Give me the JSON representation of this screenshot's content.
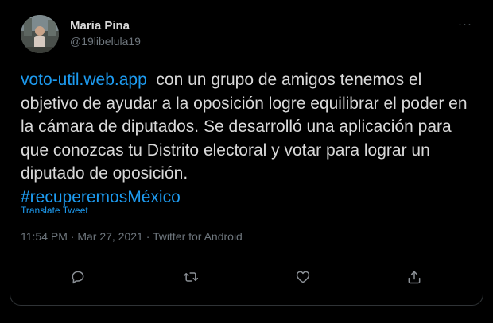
{
  "tweet": {
    "author_name": "Maria Pina",
    "author_handle": "@19libelula19",
    "more_label": "···",
    "link_text": "voto-util.web.app",
    "text": "  con un grupo de amigos tenemos el objetivo de ayudar a la oposición logre equilibrar el poder en la cámara de diputados. Se desarrolló una aplicación para que conozcas tu Distrito electoral y votar para lograr un diputado de oposición.",
    "hashtag": "#recuperemosMéxico",
    "translate_label": "Translate Tweet",
    "meta": "11:54 PM · Mar 27, 2021 · Twitter for Android"
  },
  "actions": {
    "reply_icon": "reply-icon",
    "retweet_icon": "retweet-icon",
    "like_icon": "heart-icon",
    "share_icon": "share-icon"
  },
  "colors": {
    "background": "#000000",
    "text": "#d9d9d9",
    "secondary": "#6e767d",
    "link": "#1d9bf0",
    "border": "#2f3336"
  }
}
